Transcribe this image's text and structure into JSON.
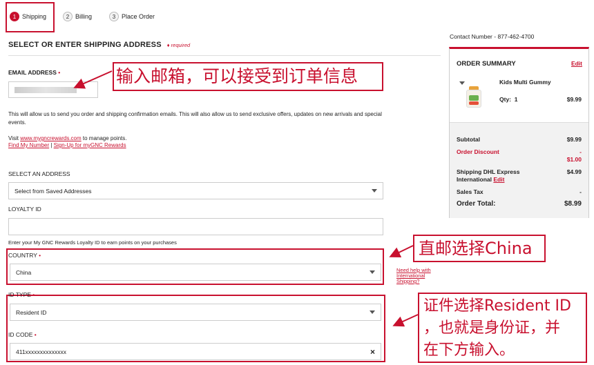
{
  "steps": [
    {
      "num": "1",
      "label": "Shipping"
    },
    {
      "num": "2",
      "label": "Billing"
    },
    {
      "num": "3",
      "label": "Place Order"
    }
  ],
  "contact": "Contact Number - 877-462-4700",
  "form": {
    "title": "SELECT OR ENTER SHIPPING ADDRESS",
    "required": "required",
    "email_label": "EMAIL ADDRESS",
    "email_info": "This will allow us to send you order and shipping confirmation emails.   This will also allow us to send exclusive offers, updates on new arrivals and special events.",
    "visit_prefix": "Visit ",
    "visit_link": "www.mygncrewards.com",
    "visit_suffix": " to manage points.",
    "find_number": "Find My Number",
    "separator": " | ",
    "signup": "Sign-Up for myGNC Rewards",
    "select_address_label": "SELECT AN ADDRESS",
    "select_address_value": "Select from Saved Addresses",
    "loyalty_label": "LOYALTY ID",
    "loyalty_help": "Enter your My GNC Rewards Loyalty ID to earn points on your purchases",
    "country_label": "COUNTRY",
    "country_value": "China",
    "help_shipping": "Need help with International Shipping?",
    "idtype_label": "ID TYPE",
    "idtype_value": "Resident ID",
    "idcode_label": "ID CODE",
    "idcode_value": "411xxxxxxxxxxxxxx",
    "clear_glyph": "×"
  },
  "summary": {
    "title": "ORDER SUMMARY",
    "edit": "Edit",
    "product": "Kids Multi Gummy",
    "qty_label": "Qty:",
    "qty": "1",
    "price": "$9.99",
    "subtotal_label": "Subtotal",
    "subtotal": "$9.99",
    "discount_label": "Order Discount",
    "discount_dash": "-",
    "discount": "$1.00",
    "shipping_label": "Shipping DHL Express International",
    "shipping_edit": "Edit",
    "shipping": "$4.99",
    "tax_label": "Sales Tax",
    "tax": "-",
    "total_label": "Order Total:",
    "total": "$8.99"
  },
  "annotations": {
    "email": "输入邮箱，可以接受到订单信息",
    "country": "直邮选择China",
    "id_line1": "证件选择Resident ID",
    "id_line2": "，也就是身份证，并",
    "id_line3": "在下方输入。"
  },
  "colors": {
    "accent": "#c8102e"
  }
}
